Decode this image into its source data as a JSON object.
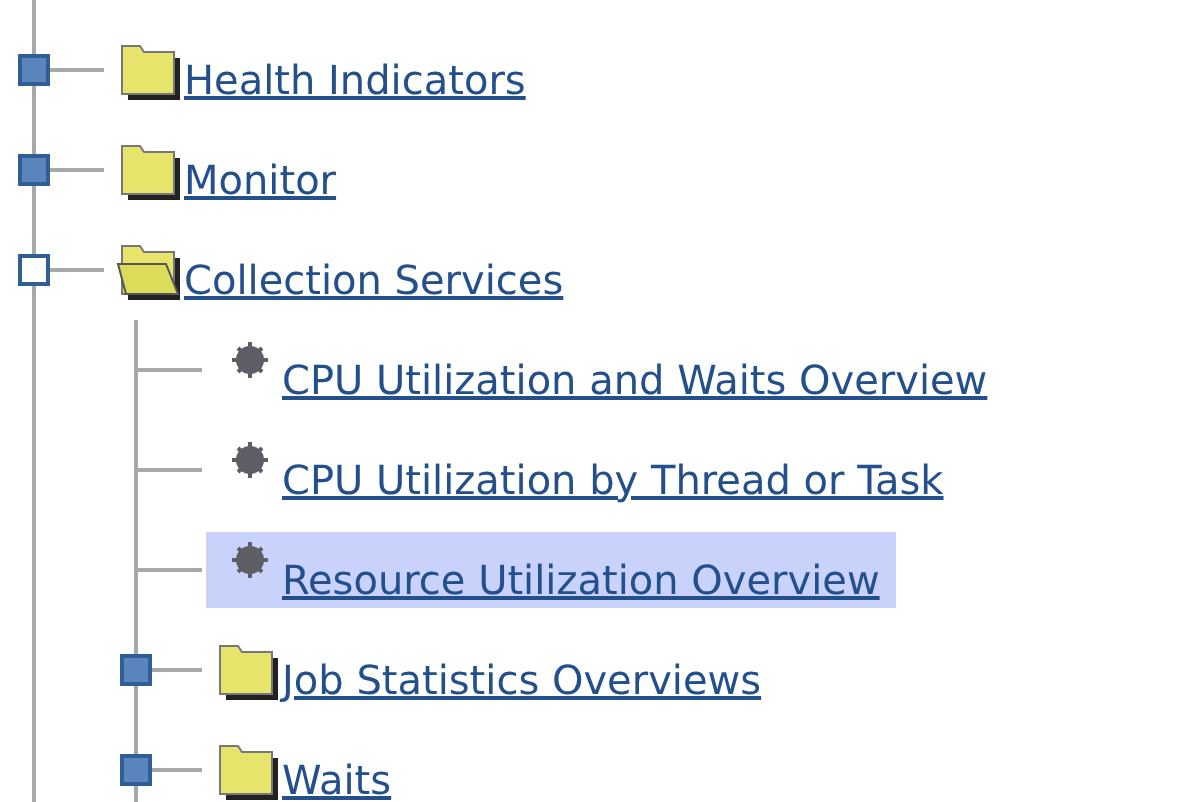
{
  "tree": [
    {
      "label": "Health Indicators",
      "expanded": false,
      "selected": false
    },
    {
      "label": "Monitor",
      "expanded": false,
      "selected": false
    },
    {
      "label": "Collection Services",
      "expanded": true,
      "selected": false,
      "children": [
        {
          "label": "CPU Utilization and Waits Overview",
          "selected": false
        },
        {
          "label": "CPU Utilization by Thread or Task",
          "selected": false
        },
        {
          "label": "Resource Utilization Overview",
          "selected": true
        },
        {
          "label": "Job Statistics Overviews",
          "expanded": false,
          "selected": false
        },
        {
          "label": "Waits",
          "expanded": false,
          "selected": false
        }
      ]
    }
  ]
}
